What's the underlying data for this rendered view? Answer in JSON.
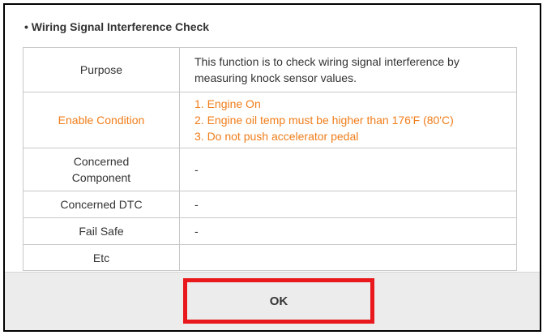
{
  "dialog": {
    "title": "• Wiring Signal Interference Check"
  },
  "table": {
    "purpose": {
      "label": "Purpose",
      "value_lines": [
        "This function is to check wiring signal interference by",
        "measuring knock sensor values."
      ]
    },
    "enable_condition": {
      "label": "Enable Condition",
      "value_lines": [
        "1. Engine On",
        "2. Engine oil temp must be higher than 176'F (80'C)",
        "3. Do not push accelerator pedal"
      ]
    },
    "concerned_component": {
      "label_lines": [
        "Concerned",
        "Component"
      ],
      "value": "-"
    },
    "concerned_dtc": {
      "label": "Concerned DTC",
      "value": "-"
    },
    "fail_safe": {
      "label": "Fail Safe",
      "value": "-"
    },
    "etc": {
      "label": "Etc",
      "value": ""
    }
  },
  "footer": {
    "ok_label": "OK"
  },
  "colors": {
    "highlight_text": "#f07d1a",
    "ok_button_outline": "#e8181d"
  }
}
